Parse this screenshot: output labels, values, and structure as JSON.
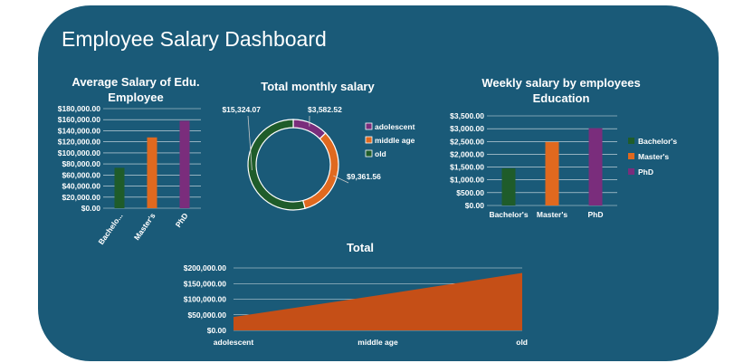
{
  "dashboard": {
    "title": "Employee Salary Dashboard"
  },
  "colors": {
    "background": "#1a5a78",
    "bachelor": "#1f5c2a",
    "masters": "#e0691f",
    "phd": "#7a2d7c",
    "area": "#c54f17",
    "grid": "#ffffff"
  },
  "chart_data": [
    {
      "type": "bar",
      "title_line1": "Average Salary of Edu.",
      "title_line2": "Employee",
      "categories": [
        "Bachelo...",
        "Master's",
        "PhD"
      ],
      "values": [
        73000,
        128000,
        158000
      ],
      "yticks": [
        "$180,000.00",
        "$160,000.00",
        "$140,000.00",
        "$120,000.00",
        "$100,000.00",
        "$80,000.00",
        "$60,000.00",
        "$40,000.00",
        "$20,000.00",
        "$0.00"
      ],
      "ylim": [
        0,
        180000
      ],
      "grid": true
    },
    {
      "type": "pie",
      "title": "Total monthly salary",
      "slices": [
        {
          "name": "adolescent",
          "value": 3582.52,
          "label": "$3,582.52"
        },
        {
          "name": "middle age",
          "value": 9361.56,
          "label": "$9,361.56"
        },
        {
          "name": "old",
          "value": 15324.07,
          "label": "$15,324.07"
        }
      ],
      "legend_position": "right"
    },
    {
      "type": "bar",
      "title_line1": "Weekly salary by employees",
      "title_line2": "Education",
      "categories": [
        "Bachelor's",
        "Master's",
        "PhD"
      ],
      "values": [
        1450,
        2480,
        3020
      ],
      "legend": [
        "Bachelor's",
        "Master's",
        "PhD"
      ],
      "yticks": [
        "$3,500.00",
        "$3,000.00",
        "$2,500.00",
        "$2,000.00",
        "$1,500.00",
        "$1,000.00",
        "$500.00",
        "$0.00"
      ],
      "ylim": [
        0,
        3500
      ],
      "grid": true,
      "legend_position": "right"
    },
    {
      "type": "area",
      "title": "Total",
      "categories": [
        "adolescent",
        "middle age",
        "old"
      ],
      "values": [
        42990,
        112339,
        183889
      ],
      "yticks": [
        "$200,000.00",
        "$150,000.00",
        "$100,000.00",
        "$50,000.00",
        "$0.00"
      ],
      "ylim": [
        0,
        200000
      ],
      "grid": true
    }
  ]
}
